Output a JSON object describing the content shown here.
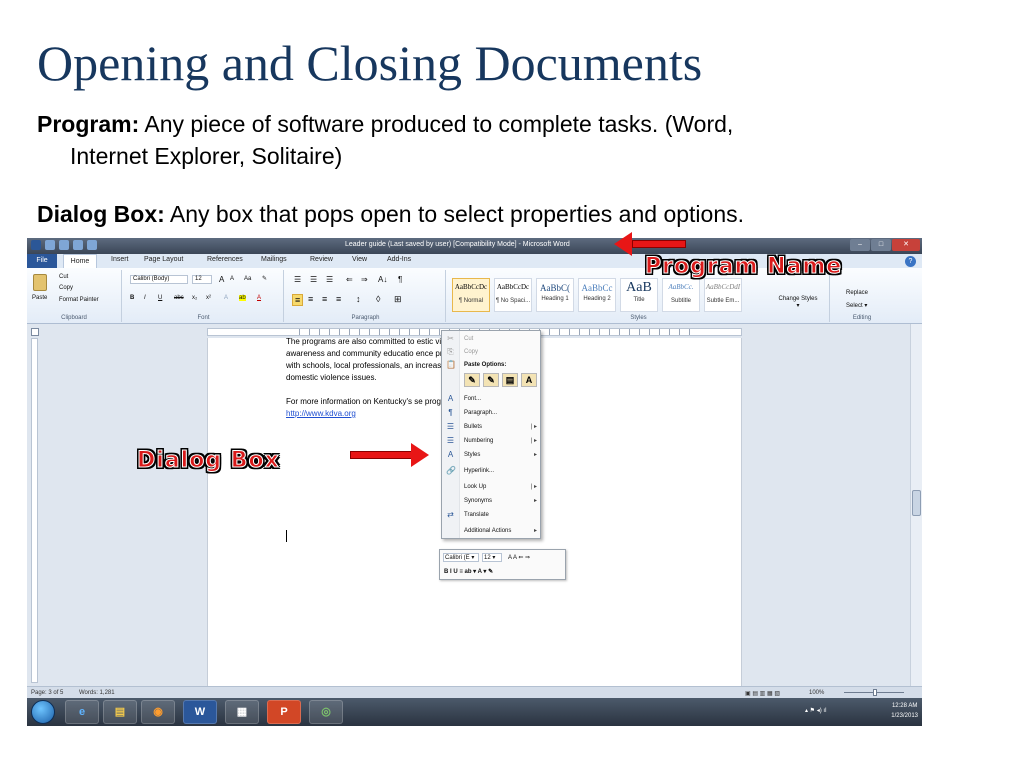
{
  "slide": {
    "title": "Opening and Closing Documents",
    "definitions": [
      {
        "term": "Program:",
        "text_line1": " Any piece of software produced to complete tasks. (Word,",
        "text_line2": "Internet Explorer, Solitaire)"
      },
      {
        "term": "Dialog Box:",
        "text": " Any box that pops open to select properties and options."
      }
    ]
  },
  "annotations": {
    "program_name": "Program Name",
    "dialog_box": "Dialog Box",
    "arrow_color": "#e81616"
  },
  "window": {
    "title": "Leader guide (Last saved by user) [Compatibility Mode] - Microsoft Word",
    "buttons": {
      "minimize": "–",
      "maximize": "□",
      "close": "✕"
    },
    "help": "?"
  },
  "tabs": [
    "File",
    "Home",
    "Insert",
    "Page Layout",
    "References",
    "Mailings",
    "Review",
    "View",
    "Add-Ins"
  ],
  "ribbon": {
    "clipboard": {
      "paste": "Paste",
      "cut": "Cut",
      "copy": "Copy",
      "format_painter": "Format Painter",
      "label": "Clipboard"
    },
    "font": {
      "name": "Calibri (Body)",
      "size": "12",
      "grow": "A",
      "shrink": "A",
      "case": "Aa",
      "clear": "✎",
      "bold": "B",
      "italic": "I",
      "underline": "U",
      "strike": "abc",
      "sub": "x₂",
      "sup": "x²",
      "effects": "A",
      "highlight": "ab",
      "color": "A",
      "label": "Font"
    },
    "paragraph": {
      "bullets": "☰",
      "numbering": "☰",
      "multilevel": "☰",
      "decrease": "⇐",
      "increase": "⇒",
      "sort": "A↓",
      "pilcrow": "¶",
      "align_left": "≡",
      "center": "≡",
      "align_right": "≡",
      "justify": "≡",
      "spacing": "↕",
      "shading": "◊",
      "border": "⊞",
      "label": "Paragraph"
    },
    "styles": {
      "items": [
        {
          "sample": "AaBbCcDc",
          "name": "¶ Normal"
        },
        {
          "sample": "AaBbCcDc",
          "name": "¶ No Spaci..."
        },
        {
          "sample": "AaBbC(",
          "name": "Heading 1"
        },
        {
          "sample": "AaBbCc",
          "name": "Heading 2"
        },
        {
          "sample": "AaB",
          "name": "Title"
        },
        {
          "sample": "AaBbCc.",
          "name": "Subtitle"
        },
        {
          "sample": "AaBbCcDdI",
          "name": "Subtle Em..."
        }
      ],
      "change": "Change Styles ▾",
      "label": "Styles"
    },
    "editing": {
      "replace": "Replace",
      "select": "Select ▾",
      "label": "Editing"
    }
  },
  "document": {
    "line1": "The programs are also committed to                              estic violence through public",
    "line2": "awareness and community educatio                               ence programs are working",
    "line3": "with schools, local professionals, an                              increase understanding of",
    "line4": "domestic violence issues.",
    "line5": "For more information on Kentucky's                            se programs visit -",
    "link": "http://www.kdva.org"
  },
  "context_menu": {
    "items": [
      {
        "icon": "✂",
        "label": "Cut",
        "disabled": true
      },
      {
        "icon": "⎘",
        "label": "Copy",
        "disabled": true
      },
      {
        "icon": "📋",
        "label": "Paste Options:",
        "header": true
      },
      {
        "icon": "A",
        "label": "Font..."
      },
      {
        "icon": "¶",
        "label": "Paragraph..."
      },
      {
        "icon": "☰",
        "label": "Bullets",
        "submenu": "|  ▸"
      },
      {
        "icon": "☰",
        "label": "Numbering",
        "submenu": "|  ▸"
      },
      {
        "icon": "A",
        "label": "Styles",
        "submenu": "▸"
      },
      {
        "icon": "🔗",
        "label": "Hyperlink..."
      },
      {
        "icon": "",
        "label": "Look Up",
        "submenu": "|  ▸"
      },
      {
        "icon": "",
        "label": "Synonyms",
        "submenu": "▸"
      },
      {
        "icon": "⇄",
        "label": "Translate"
      },
      {
        "icon": "",
        "label": "Additional Actions",
        "submenu": "▸"
      }
    ],
    "paste_options": [
      "✎",
      "✎",
      "▤",
      "A"
    ]
  },
  "mini_toolbar": {
    "font": "Calibri (E ▾",
    "size": "12 ▾",
    "row1_tools": "A  A  ⇐  ⇒",
    "row2_tools": "B   I   U   ≡   ab ▾   A ▾   ✎"
  },
  "status_bar": {
    "page": "Page: 3 of 5",
    "words": "Words: 1,281",
    "zoom": "100%",
    "zoom_level": 100,
    "view_icons": "▣ ▤ ▥ ▦ ▧"
  },
  "taskbar": {
    "apps": [
      "e",
      "▤",
      "◉",
      "W",
      "▦",
      "P",
      "◎"
    ],
    "time": "12:28 AM",
    "date": "1/23/2013",
    "tray_icons": "▴  ⚑  ◂)  ıl"
  }
}
